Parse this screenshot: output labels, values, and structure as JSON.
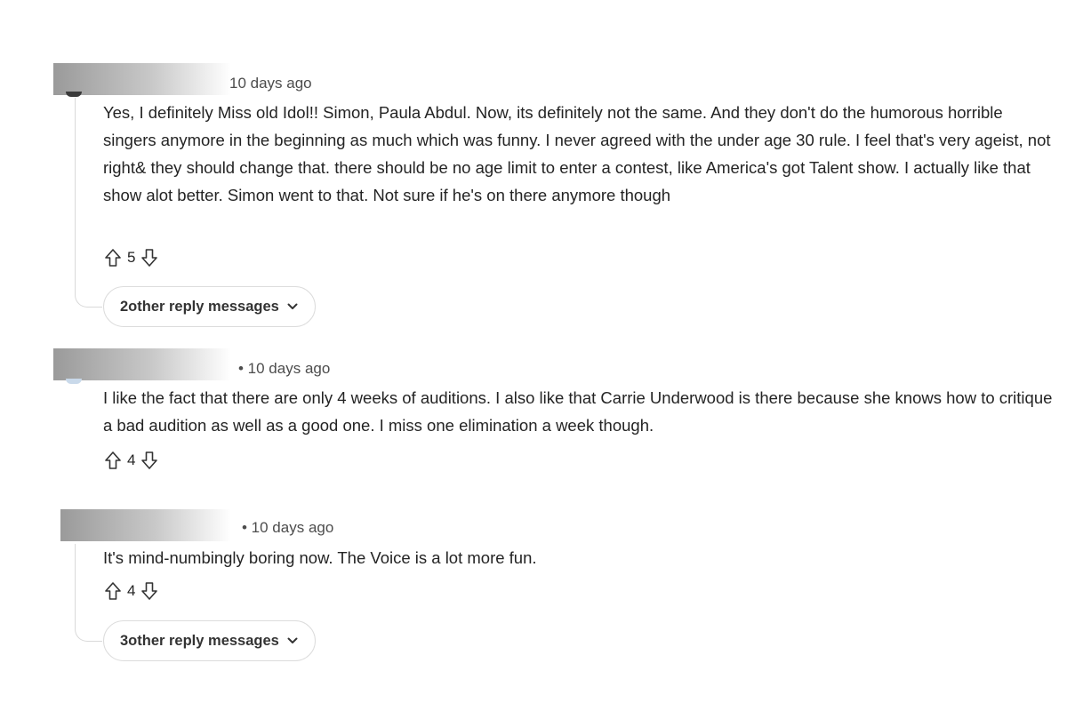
{
  "comments": [
    {
      "meta": "10 days ago",
      "text": "Yes, I  definitely Miss old Idol!! Simon, Paula Abdul. Now, its definitely not the same. And they don't do the humorous horrible singers anymore in the beginning as much which was funny. I never agreed with the under age 30 rule. I feel that's very ageist, not right& they should change that. there should be no age limit to enter a contest, like America's got Talent show. I actually like that show alot better. Simon went to that. Not sure if he's on there anymore though",
      "votes": "5",
      "replies_label": "2other reply messages"
    },
    {
      "meta": "• 10 days ago",
      "text": "I like the fact that there are only 4 weeks of auditions. I also like that Carrie Underwood is there because she knows how to critique a bad audition as well as a good one. I miss one elimination a week though.",
      "votes": "4"
    },
    {
      "meta": "• 10 days ago",
      "text": "It's mind-numbingly boring now. The Voice is a lot more fun.",
      "votes": "4",
      "replies_label": "3other reply messages"
    }
  ],
  "icons": {
    "upvote": "arrow-up-outline-icon",
    "downvote": "arrow-down-outline-icon",
    "expand": "chevron-down-icon"
  },
  "colors": {
    "text": "#242424",
    "meta": "#4d4d4d",
    "border": "#dcdcdc"
  }
}
